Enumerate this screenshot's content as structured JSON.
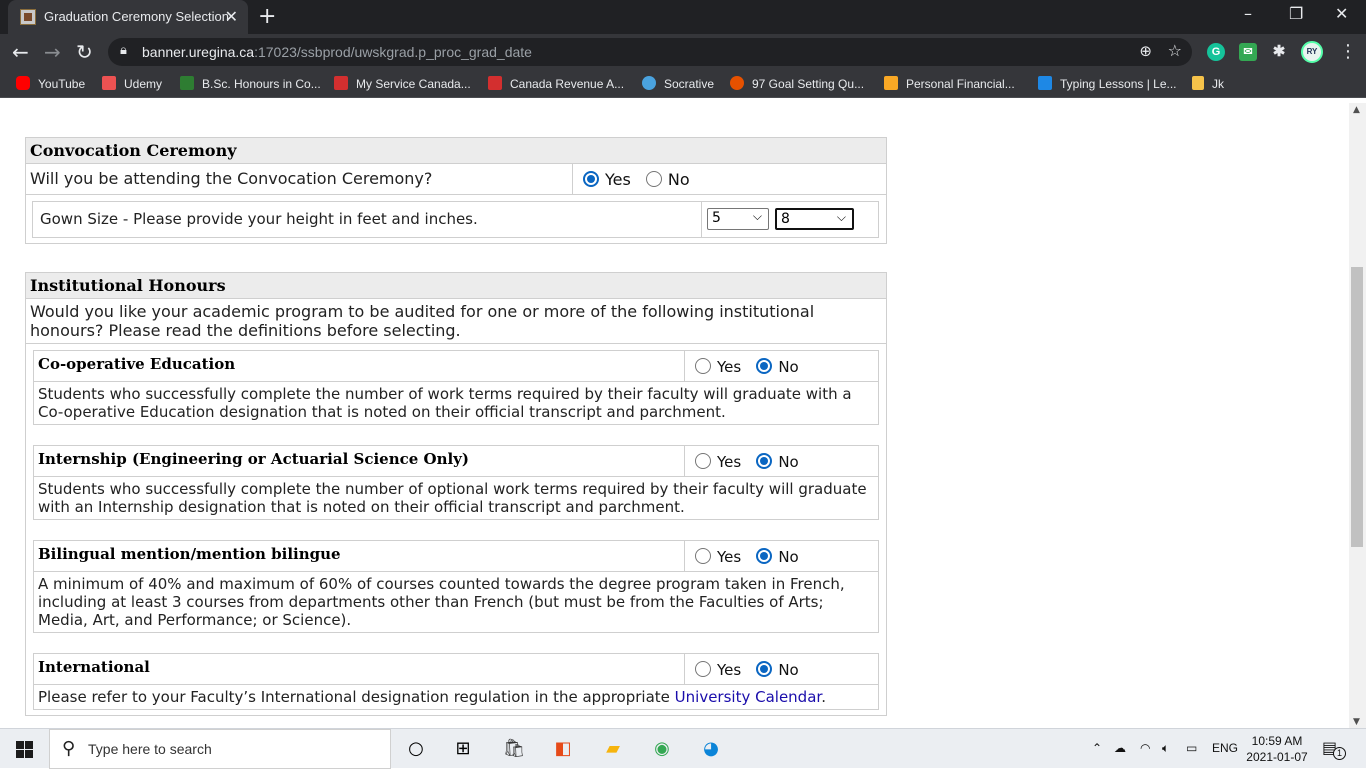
{
  "browser": {
    "tab_title": "Graduation Ceremony Selection",
    "tab_close": "✕",
    "new_tab": "+",
    "url_host": "banner.uregina.ca",
    "url_rest": ":17023/ssbprod/uwskgrad.p_proc_grad_date",
    "profile_initials": "RY",
    "window_controls": {
      "minimize": "–",
      "maximize": "❐",
      "close": "✕"
    }
  },
  "bookmarks": [
    {
      "label": "YouTube",
      "icon": "youtube-icon",
      "color": "#ff0000"
    },
    {
      "label": "Udemy",
      "icon": "udemy-icon",
      "color": "#ec5252"
    },
    {
      "label": "B.Sc. Honours in Co...",
      "icon": "ur-icon",
      "color": "#2e7d32"
    },
    {
      "label": "My Service Canada...",
      "icon": "maple-leaf-icon",
      "color": "#d32f2f"
    },
    {
      "label": "Canada Revenue A...",
      "icon": "maple-leaf-icon",
      "color": "#d32f2f"
    },
    {
      "label": "Socrative",
      "icon": "socrative-icon",
      "color": "#4aa3df"
    },
    {
      "label": "97 Goal Setting Qu...",
      "icon": "target-icon",
      "color": "#e65100"
    },
    {
      "label": "Personal Financial...",
      "icon": "financial-icon",
      "color": "#f9a825"
    },
    {
      "label": "Typing Lessons | Le...",
      "icon": "typing-icon",
      "color": "#1e88e5"
    },
    {
      "label": "Jk",
      "icon": "folder-icon",
      "color": "#f6c34a"
    }
  ],
  "convocation": {
    "heading": "Convocation Ceremony",
    "question": "Will you be attending the Convocation Ceremony?",
    "yes": "Yes",
    "no": "No",
    "gown_label": "Gown Size - Please provide your height in feet and inches.",
    "feet": "5",
    "inches": "8"
  },
  "honours": {
    "heading": "Institutional Honours",
    "intro": "Would you like your academic program to be audited for one or more of the following institutional honours? Please read the definitions before selecting.",
    "items": [
      {
        "name": "Co-operative Education",
        "desc": "Students who successfully complete the number of work terms required by their faculty will graduate with a Co-operative Education designation that is noted on their official transcript and parchment.",
        "yes": "Yes",
        "no": "No"
      },
      {
        "name": "Internship (Engineering or Actuarial Science Only)",
        "desc": "Students who successfully complete the number of optional work terms required by their faculty will graduate with an Internship designation that is noted on their official transcript and parchment.",
        "yes": "Yes",
        "no": "No"
      },
      {
        "name": "Bilingual mention/mention bilingue",
        "desc": "A minimum of 40% and maximum of 60% of courses counted towards the degree program taken in French, including at least 3 courses from departments other than French (but must be from the Faculties of Arts; Media, Art, and Performance; or Science).",
        "yes": "Yes",
        "no": "No"
      },
      {
        "name": "International",
        "desc_before": "Please refer to your Faculty’s International designation regulation in the appropriate ",
        "link": "University Calendar",
        "desc_after": ".",
        "yes": "Yes",
        "no": "No"
      }
    ]
  },
  "taskbar": {
    "search_placeholder": "Type here to search",
    "lang": "ENG",
    "time": "10:59 AM",
    "date": "2021-01-07",
    "notification_count": "1"
  }
}
